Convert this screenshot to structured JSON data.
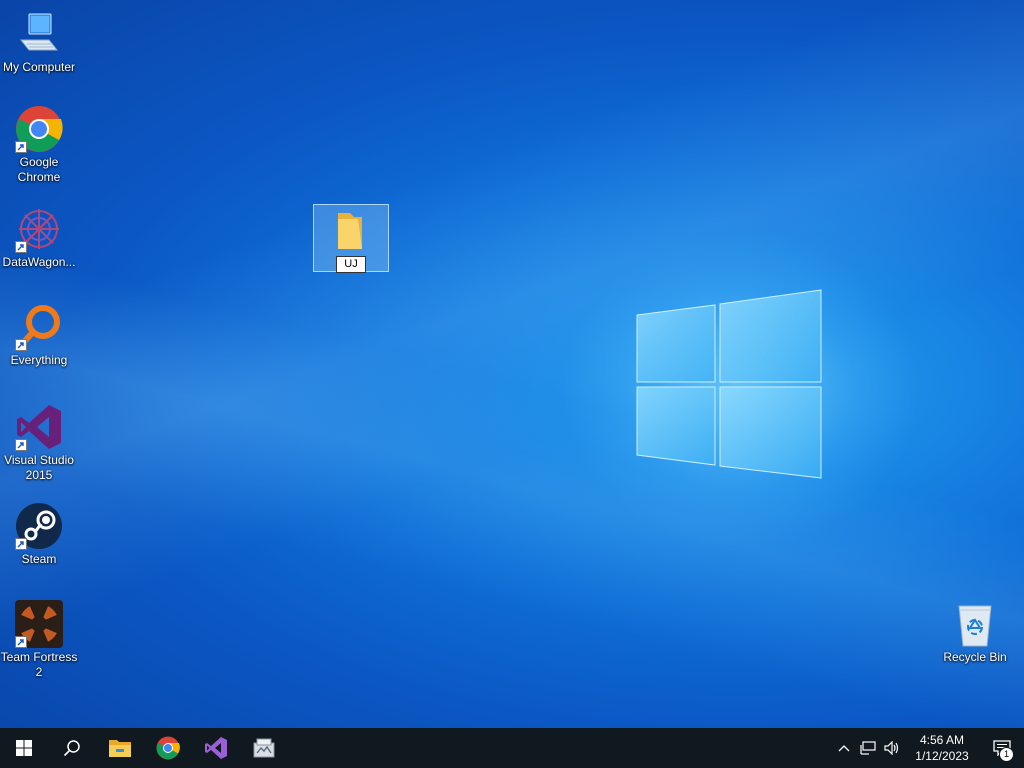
{
  "desktop": {
    "icons": [
      {
        "label": "My Computer",
        "icon": "computer-icon"
      },
      {
        "label": "Google Chrome",
        "icon": "chrome-icon"
      },
      {
        "label": "DataWagon...",
        "icon": "datawagon-icon"
      },
      {
        "label": "Everything",
        "icon": "everything-icon"
      },
      {
        "label": "Visual Studio 2015",
        "icon": "visual-studio-icon"
      },
      {
        "label": "Steam",
        "icon": "steam-icon"
      },
      {
        "label": "Team Fortress 2",
        "icon": "team-fortress-icon"
      }
    ],
    "recycle_bin": {
      "label": "Recycle Bin",
      "icon": "recycle-bin-icon"
    },
    "selected_folder": {
      "rename_value": "UJ",
      "icon": "folder-icon"
    }
  },
  "taskbar": {
    "pinned": [
      {
        "icon": "windows-start-icon"
      },
      {
        "icon": "search-icon"
      },
      {
        "icon": "file-explorer-icon"
      },
      {
        "icon": "chrome-icon"
      },
      {
        "icon": "visual-studio-icon"
      },
      {
        "icon": "app-icon"
      }
    ],
    "tray": {
      "time": "4:56 AM",
      "date": "1/12/2023",
      "notification_count": "1"
    }
  },
  "colors": {
    "taskbar": "#101820",
    "desktop_accent": "#0f6fd8"
  }
}
